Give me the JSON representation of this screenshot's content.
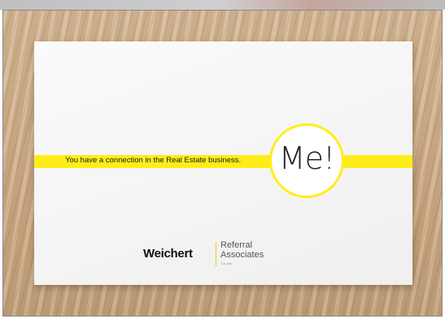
{
  "card": {
    "tagline": "You have a connection in the Real Estate business.",
    "circle_text": "Me!",
    "logo": {
      "brand": "Weichert",
      "line1": "Referral",
      "line2": "Associates",
      "line3": "Co. Inc."
    }
  },
  "colors": {
    "accent_yellow": "#ffed1a",
    "card_white": "#f7f7f7",
    "wood": "#cfae8a"
  }
}
